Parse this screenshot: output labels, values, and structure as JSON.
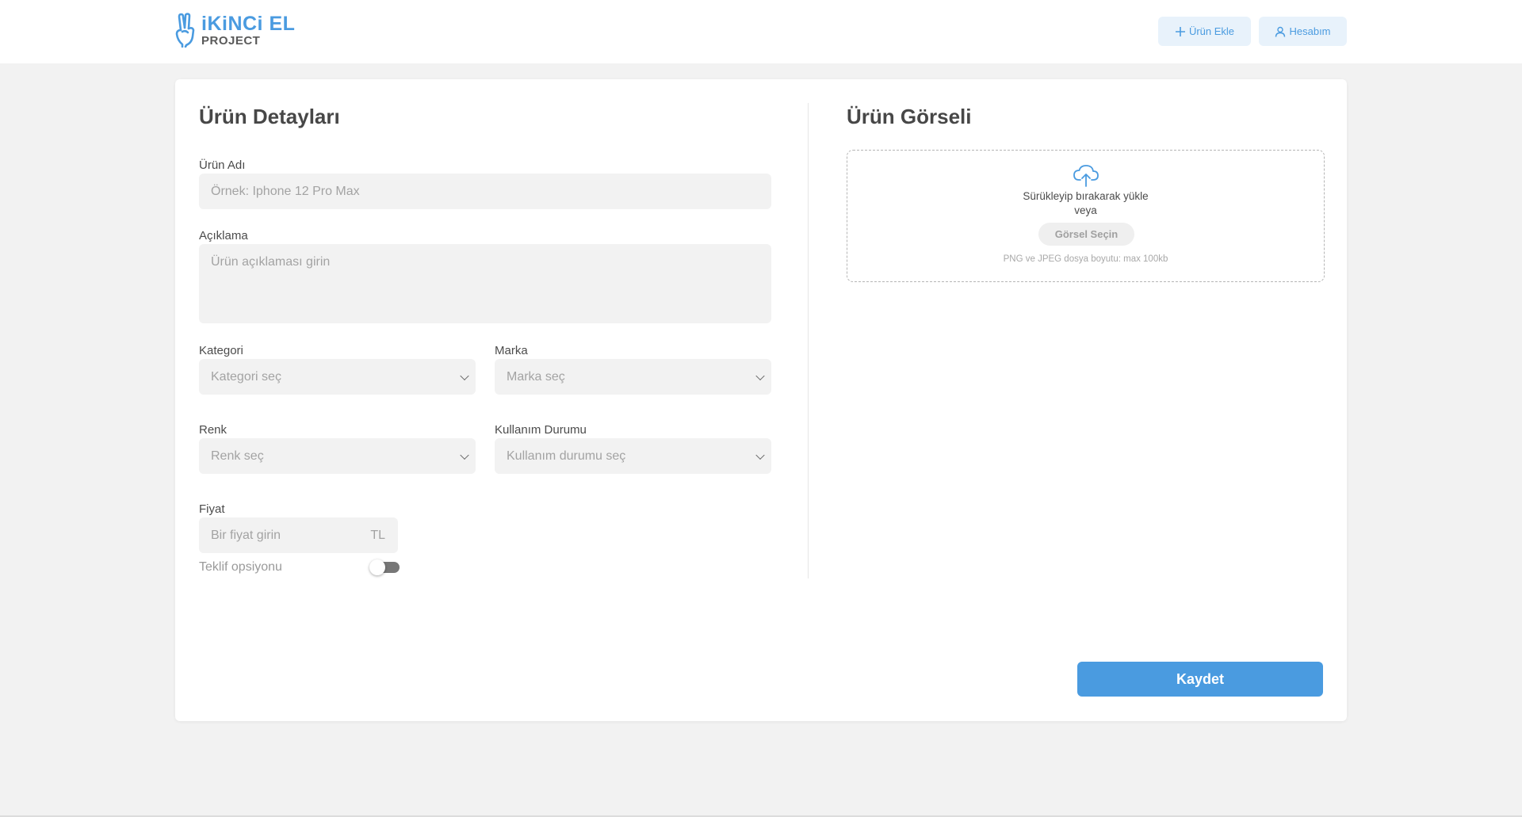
{
  "header": {
    "logo_title": "iKiNCi EL",
    "logo_subtitle": "PROJECT",
    "add_product_label": "Ürün Ekle",
    "account_label": "Hesabım"
  },
  "details": {
    "title": "Ürün Detayları",
    "name_label": "Ürün Adı",
    "name_placeholder": "Örnek: Iphone 12 Pro Max",
    "description_label": "Açıklama",
    "description_placeholder": "Ürün açıklaması girin",
    "category_label": "Kategori",
    "category_value": "Kategori seç",
    "brand_label": "Marka",
    "brand_value": "Marka seç",
    "color_label": "Renk",
    "color_value": "Renk seç",
    "condition_label": "Kullanım Durumu",
    "condition_value": "Kullanım durumu seç",
    "price_label": "Fiyat",
    "price_placeholder": "Bir fiyat girin",
    "price_currency": "TL",
    "offer_label": "Teklif opsiyonu",
    "offer_enabled": false
  },
  "image": {
    "title": "Ürün Görseli",
    "drop_text_line1": "Sürükleyip bırakarak yükle",
    "drop_text_line2": "veya",
    "pick_button": "Görsel Seçin",
    "note": "PNG ve JPEG dosya boyutu: max 100kb"
  },
  "actions": {
    "save_label": "Kaydet"
  },
  "colors": {
    "accent": "#4a9be0",
    "background": "#f2f2f2",
    "field": "#f2f2f2"
  }
}
